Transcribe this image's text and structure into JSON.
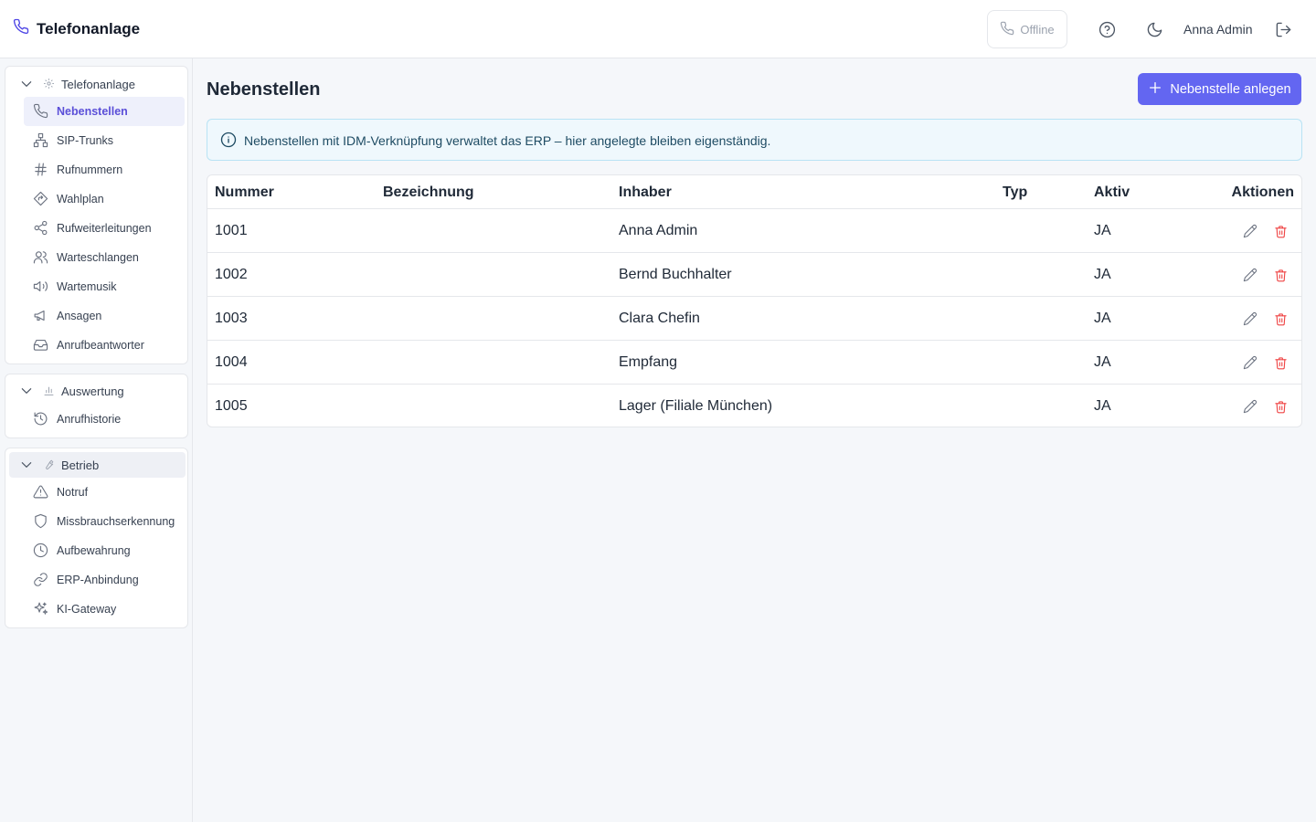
{
  "app": {
    "title": "Telefonanlage"
  },
  "header": {
    "status_label": "Offline",
    "user_name": "Anna Admin"
  },
  "sidebar": {
    "groups": [
      {
        "label": "Telefonanlage",
        "icon": "gear-icon",
        "items": [
          {
            "label": "Nebenstellen",
            "icon": "phone-icon",
            "active": true
          },
          {
            "label": "SIP-Trunks",
            "icon": "network-icon"
          },
          {
            "label": "Rufnummern",
            "icon": "hash-icon"
          },
          {
            "label": "Wahlplan",
            "icon": "route-icon"
          },
          {
            "label": "Rufweiterleitungen",
            "icon": "share-icon"
          },
          {
            "label": "Warteschlangen",
            "icon": "users-icon"
          },
          {
            "label": "Wartemusik",
            "icon": "speaker-icon"
          },
          {
            "label": "Ansagen",
            "icon": "megaphone-icon"
          },
          {
            "label": "Anrufbeantworter",
            "icon": "inbox-icon"
          }
        ]
      },
      {
        "label": "Auswertung",
        "icon": "chart-icon",
        "items": [
          {
            "label": "Anrufhistorie",
            "icon": "history-icon"
          }
        ]
      },
      {
        "label": "Betrieb",
        "icon": "wrench-icon",
        "items": [
          {
            "label": "Notruf",
            "icon": "warning-icon"
          },
          {
            "label": "Missbrauchserkennung",
            "icon": "shield-icon"
          },
          {
            "label": "Aufbewahrung",
            "icon": "clock-icon"
          },
          {
            "label": "ERP-Anbindung",
            "icon": "link-icon"
          },
          {
            "label": "KI-Gateway",
            "icon": "sparkles-icon"
          }
        ]
      }
    ]
  },
  "main": {
    "title": "Nebenstellen",
    "add_button_label": "Nebenstelle anlegen",
    "info_text": "Nebenstellen mit IDM-Verknüpfung verwaltet das ERP – hier angelegte bleiben eigenständig.",
    "table": {
      "columns": [
        "Nummer",
        "Bezeichnung",
        "Inhaber",
        "Typ",
        "Aktiv",
        "Aktionen"
      ],
      "rows": [
        {
          "nummer": "1001",
          "bezeichnung": "",
          "inhaber": "Anna Admin",
          "typ": "",
          "aktiv": "JA"
        },
        {
          "nummer": "1002",
          "bezeichnung": "",
          "inhaber": "Bernd Buchhalter",
          "typ": "",
          "aktiv": "JA"
        },
        {
          "nummer": "1003",
          "bezeichnung": "",
          "inhaber": "Clara Chefin",
          "typ": "",
          "aktiv": "JA"
        },
        {
          "nummer": "1004",
          "bezeichnung": "",
          "inhaber": "Empfang",
          "typ": "",
          "aktiv": "JA"
        },
        {
          "nummer": "1005",
          "bezeichnung": "",
          "inhaber": "Lager (Filiale München)",
          "typ": "",
          "aktiv": "JA"
        }
      ]
    }
  },
  "colors": {
    "accent": "#6366f1",
    "active_text": "#5b4fd8",
    "danger": "#ef4444",
    "info_bg": "#eff8fd",
    "info_border": "#b9e3f4"
  }
}
